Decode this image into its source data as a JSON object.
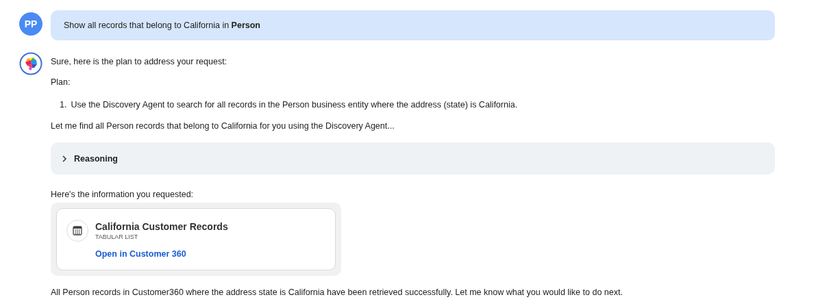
{
  "user_message": {
    "avatar_initials": "PP",
    "text": "Show all records that belong to California in **Person**"
  },
  "assistant_message": {
    "intro": "Sure, here is the plan to address your request:",
    "plan_label": "Plan:",
    "steps": [
      {
        "number": "1.",
        "text": "Use the Discovery Agent to search for all records in the Person business entity where the address (state) is California."
      }
    ],
    "followup": "Let me find all Person records that belong to California for you using the Discovery Agent...",
    "reasoning": {
      "label": "Reasoning",
      "expanded": false
    },
    "result_intro": "Here's the information you requested:",
    "result_card": {
      "title": "California Customer Records",
      "subtitle": "TABULAR LIST",
      "link": "Open in Customer 360"
    },
    "closing": "All Person records in Customer360 where the address state is California have been retrieved successfully. Let me know what you would like to do next."
  }
}
